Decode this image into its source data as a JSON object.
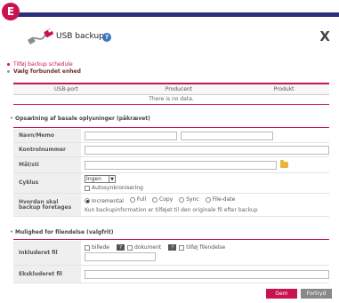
{
  "badge": "E",
  "dialog": {
    "title": "USB backup",
    "help": "?",
    "close": "X"
  },
  "steps": [
    {
      "label": "Tilføj backup schedule",
      "active": true
    },
    {
      "label": "Vælg forbundet enhed",
      "active": false
    }
  ],
  "port_table": {
    "headers": [
      "USB-port",
      "Producent",
      "Produkt"
    ],
    "empty_text": "There is no data."
  },
  "basic_section": {
    "title": "Opsætning af basale oplysninger (påkrævet)",
    "name_label": "Navn/Memo",
    "control_label": "Kontrolnummer",
    "target_label": "Mål/sti",
    "cycle_label": "Cyklus",
    "cycle_value": "Ingen",
    "autosync_label": "Autosynkronisering",
    "how_label": "Hvordan skal backup foretages",
    "methods": [
      "Incremental",
      "Full",
      "Copy",
      "Sync",
      "File-date"
    ],
    "selected_method": "Incremental",
    "how_hint": "Kun backupinformation er tilføjet til den originale fil efter backup"
  },
  "filter_section": {
    "title": "Mulighed for filendelse (valgfrit)",
    "include_label": "Inkluderet fil",
    "include_options": [
      "billede",
      "dokument",
      "tilføj filendelse"
    ],
    "exclude_label": "Ekskluderet fil",
    "qmark": "?"
  },
  "buttons": {
    "save": "Gem",
    "continue": "Fortryd"
  },
  "colors": {
    "accent": "#c8134f",
    "topbar": "#2b2f7a"
  }
}
